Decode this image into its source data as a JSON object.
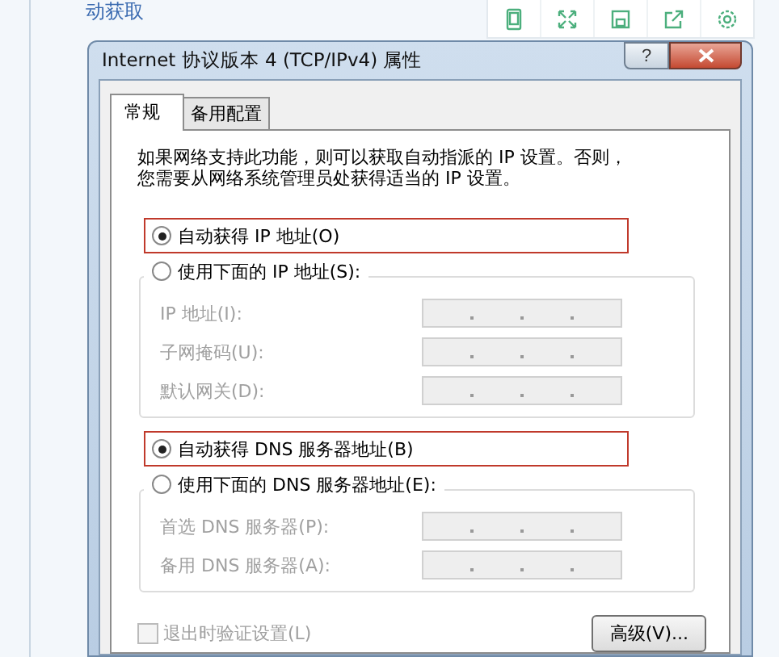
{
  "background_text": "动获取",
  "dialog": {
    "title": "Internet 协议版本 4 (TCP/IPv4) 属性",
    "help_label": "?"
  },
  "tabs": [
    {
      "label": "常规",
      "selected": true
    },
    {
      "label": "备用配置",
      "selected": false
    }
  ],
  "description": [
    "如果网络支持此功能，则可以获取自动指派的 IP 设置。否则，",
    "您需要从网络系统管理员处获得适当的 IP 设置。"
  ],
  "sections": [
    {
      "options": [
        {
          "label": "自动获得 IP 地址(O)",
          "selected": true,
          "highlighted": true
        },
        {
          "label": "使用下面的 IP 地址(S):",
          "selected": false,
          "highlighted": false
        }
      ],
      "disabled": true,
      "fields": [
        {
          "label": "IP 地址(I):"
        },
        {
          "label": "子网掩码(U):"
        },
        {
          "label": "默认网关(D):"
        }
      ]
    },
    {
      "options": [
        {
          "label": "自动获得 DNS 服务器地址(B)",
          "selected": true,
          "highlighted": true
        },
        {
          "label": "使用下面的 DNS 服务器地址(E):",
          "selected": false,
          "highlighted": false
        }
      ],
      "disabled": true,
      "fields": [
        {
          "label": "首选 DNS 服务器(P):"
        },
        {
          "label": "备用 DNS 服务器(A):"
        }
      ]
    }
  ],
  "validate": {
    "label": "退出时验证设置(L)",
    "checked": false,
    "disabled": true
  },
  "advanced_button": "高级(V)..."
}
